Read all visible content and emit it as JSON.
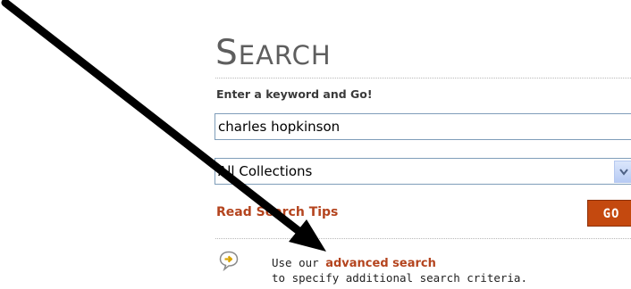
{
  "search": {
    "title_first": "S",
    "title_rest": "EARCH",
    "keyword_label": "Enter a keyword and Go!",
    "keyword_value": "charles hopkinson",
    "collection_selected": "All Collections",
    "tips_link": "Read Search Tips",
    "go_label": "GO"
  },
  "advanced": {
    "prefix": "Use our ",
    "link": "advanced search",
    "suffix": "to specify additional search criteria."
  },
  "icons": {
    "bubble": "speech-bubble-arrow-icon",
    "select_arrow": "chevron-down-icon",
    "annotation": "annotation-arrow"
  },
  "colors": {
    "accent": "#b4441e",
    "go_button": "#c4490f",
    "title": "#5e5e5e",
    "annotation_arrow": "#000000"
  }
}
